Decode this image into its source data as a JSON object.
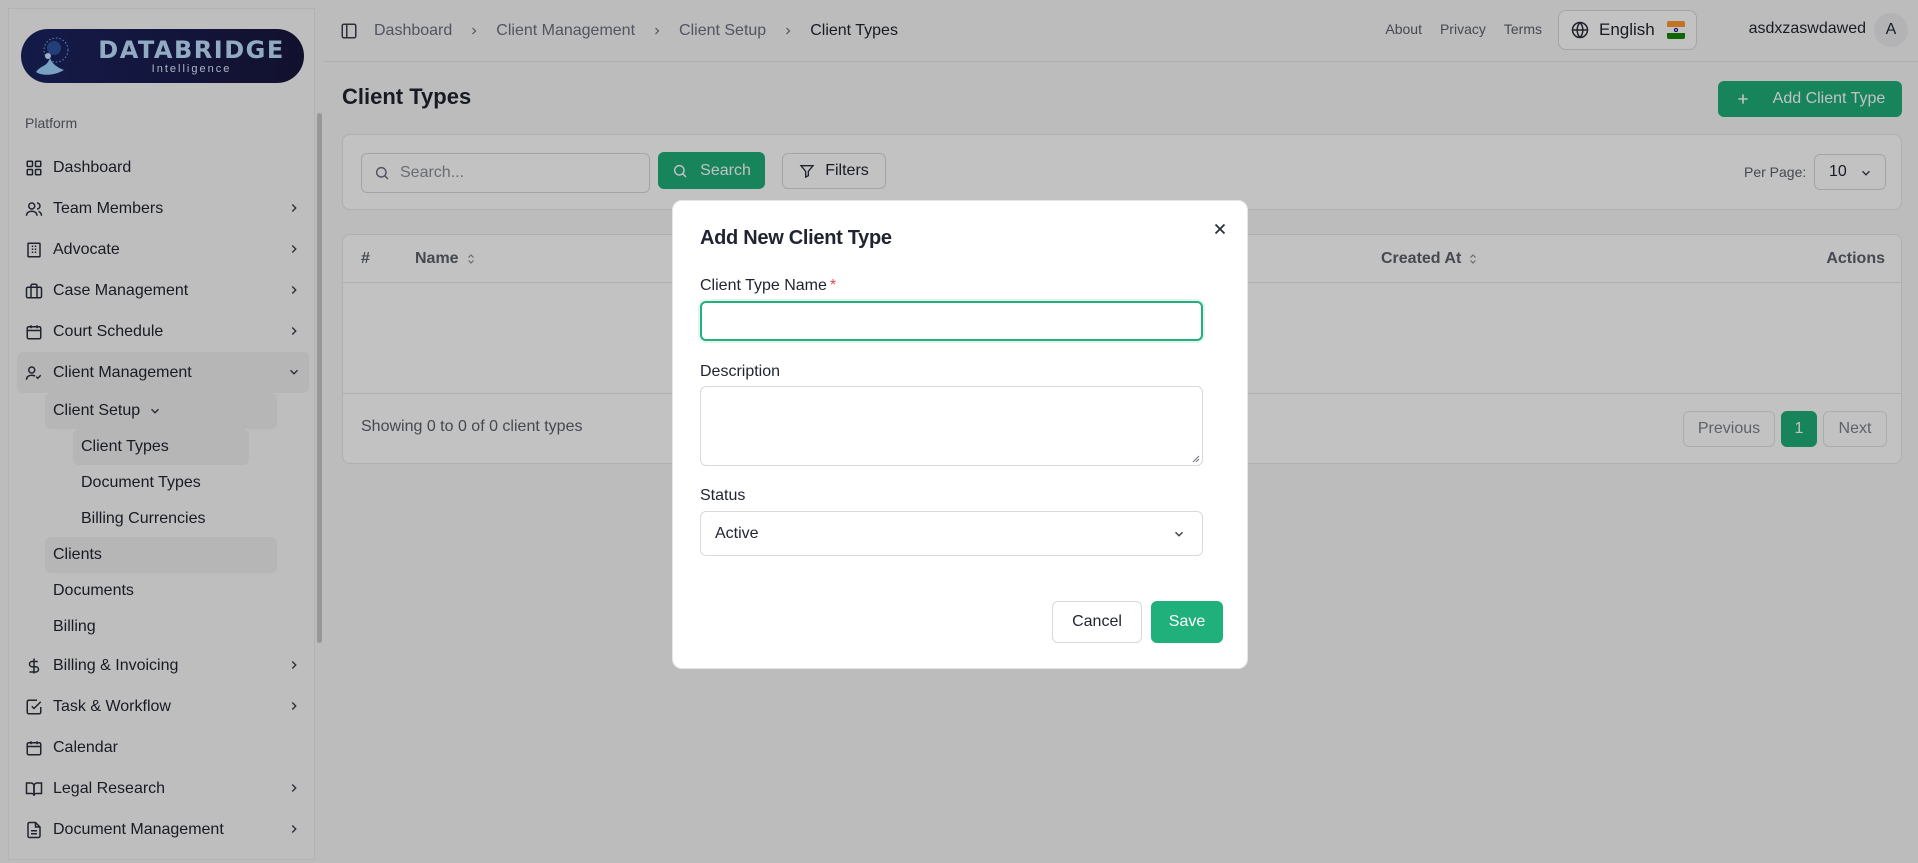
{
  "brand": {
    "name": "DATABRIDGE",
    "tagline": "Intelligence"
  },
  "sidebar": {
    "section_label": "Platform",
    "items": [
      {
        "label": "Dashboard",
        "icon": "grid-icon"
      },
      {
        "label": "Team Members",
        "icon": "users-icon"
      },
      {
        "label": "Advocate",
        "icon": "building-icon"
      },
      {
        "label": "Case Management",
        "icon": "briefcase-icon"
      },
      {
        "label": "Court Schedule",
        "icon": "calendar-icon"
      },
      {
        "label": "Client Management",
        "icon": "user-check-icon"
      },
      {
        "label": "Billing & Invoicing",
        "icon": "dollar-icon"
      },
      {
        "label": "Task & Workflow",
        "icon": "check-square-icon"
      },
      {
        "label": "Calendar",
        "icon": "calendar-icon"
      },
      {
        "label": "Legal Research",
        "icon": "book-open-icon"
      },
      {
        "label": "Document Management",
        "icon": "file-text-icon"
      }
    ],
    "client_management_sub": {
      "client_setup": "Client Setup",
      "client_setup_items": [
        "Client Types",
        "Document Types",
        "Billing Currencies"
      ],
      "others": [
        "Clients",
        "Documents",
        "Billing"
      ]
    }
  },
  "topbar": {
    "breadcrumbs": [
      "Dashboard",
      "Client Management",
      "Client Setup",
      "Client Types"
    ],
    "links": [
      "About",
      "Privacy",
      "Terms"
    ],
    "language": "English",
    "username": "asdxzaswdawed",
    "avatar_initial": "A"
  },
  "main": {
    "title": "Client Types",
    "add_button": "Add Client Type",
    "search_placeholder": "Search...",
    "search_button": "Search",
    "filters_button": "Filters",
    "per_page_label": "Per Page:",
    "per_page_value": "10",
    "table": {
      "columns": [
        "#",
        "Name",
        "Created At",
        "Actions"
      ]
    },
    "showing_text": "Showing 0 to 0 of 0 client types",
    "pagination": {
      "previous": "Previous",
      "current": "1",
      "next": "Next"
    }
  },
  "modal": {
    "title": "Add New Client Type",
    "name_label": "Client Type Name",
    "name_required_mark": "*",
    "description_label": "Description",
    "status_label": "Status",
    "status_value": "Active",
    "cancel": "Cancel",
    "save": "Save"
  },
  "colors": {
    "accent": "#1fae7a",
    "brand_dark": "#1a1b4c",
    "required": "#e5484d"
  }
}
